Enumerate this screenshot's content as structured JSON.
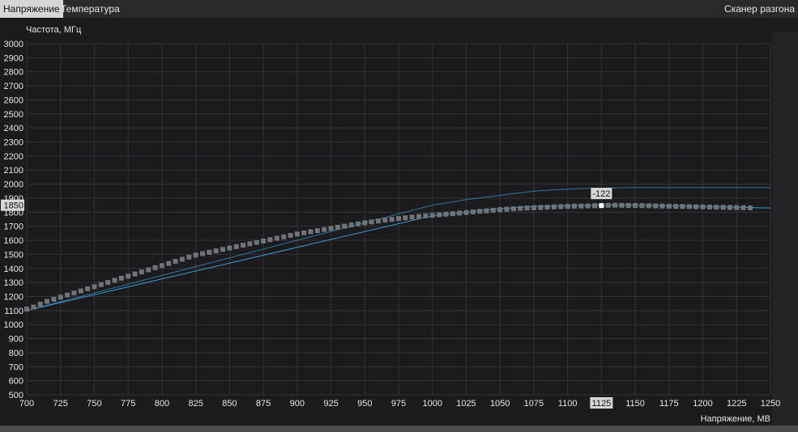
{
  "tabs": [
    {
      "label": "Напряжение",
      "active": true
    },
    {
      "label": "Температура",
      "active": false
    }
  ],
  "scanner_label": "Сканер разгона",
  "colors": {
    "grid": "#333338",
    "curve": "#3a9ad2",
    "point": "#6f7478",
    "point_selected": "#ffffff",
    "highlight_bg": "#d6d6d6"
  },
  "chart_data": {
    "type": "line",
    "ylabel": "Частота, МГц",
    "xlabel": "Напряжение, МВ",
    "xlim": [
      700,
      1250
    ],
    "ylim": [
      500,
      3000
    ],
    "x_ticks": [
      700,
      725,
      750,
      775,
      800,
      825,
      850,
      875,
      900,
      925,
      950,
      975,
      1000,
      1025,
      1050,
      1075,
      1100,
      1125,
      1150,
      1175,
      1200,
      1225,
      1250
    ],
    "y_ticks": [
      500,
      600,
      700,
      800,
      900,
      1000,
      1100,
      1200,
      1300,
      1400,
      1500,
      1600,
      1700,
      1800,
      1850,
      1900,
      2000,
      2100,
      2200,
      2300,
      2400,
      2500,
      2600,
      2700,
      2800,
      2900,
      3000
    ],
    "highlight_x": "1125",
    "highlight_y": "1850",
    "annotation": "-122",
    "series": [
      {
        "x": [
          700,
          1000,
          1025,
          1050,
          1075,
          1100,
          1125,
          1150,
          1250
        ],
        "y": [
          1100,
          1850,
          1890,
          1920,
          1950,
          1965,
          1972,
          1975,
          1975
        ]
      },
      {
        "x": [
          700,
          1000,
          1025,
          1050,
          1075,
          1100,
          1125,
          1150,
          1175,
          1200,
          1225,
          1250
        ],
        "y": [
          1100,
          1775,
          1800,
          1825,
          1840,
          1845,
          1850,
          1850,
          1845,
          1840,
          1835,
          1830
        ]
      }
    ],
    "points": {
      "x": [
        700,
        705,
        710,
        715,
        720,
        725,
        730,
        735,
        740,
        745,
        750,
        755,
        760,
        765,
        770,
        775,
        780,
        785,
        790,
        795,
        800,
        805,
        810,
        815,
        820,
        825,
        830,
        835,
        840,
        845,
        850,
        855,
        860,
        865,
        870,
        875,
        880,
        885,
        890,
        895,
        900,
        905,
        910,
        915,
        920,
        925,
        930,
        935,
        940,
        945,
        950,
        955,
        960,
        965,
        970,
        975,
        980,
        985,
        990,
        995,
        1000,
        1005,
        1010,
        1015,
        1020,
        1025,
        1030,
        1035,
        1040,
        1045,
        1050,
        1055,
        1060,
        1065,
        1070,
        1075,
        1080,
        1085,
        1090,
        1095,
        1100,
        1105,
        1110,
        1115,
        1120,
        1125,
        1130,
        1135,
        1140,
        1145,
        1150,
        1155,
        1160,
        1165,
        1170,
        1175,
        1180,
        1185,
        1190,
        1195,
        1200,
        1205,
        1210,
        1215,
        1220,
        1225,
        1230,
        1235
      ],
      "y": [
        1110,
        1125,
        1145,
        1165,
        1180,
        1195,
        1210,
        1225,
        1240,
        1255,
        1270,
        1285,
        1300,
        1315,
        1330,
        1345,
        1360,
        1375,
        1390,
        1405,
        1420,
        1435,
        1450,
        1465,
        1480,
        1495,
        1505,
        1515,
        1525,
        1535,
        1545,
        1555,
        1565,
        1575,
        1585,
        1595,
        1605,
        1615,
        1625,
        1635,
        1645,
        1653,
        1661,
        1669,
        1677,
        1685,
        1693,
        1701,
        1709,
        1717,
        1725,
        1731,
        1737,
        1743,
        1749,
        1755,
        1760,
        1765,
        1770,
        1774,
        1778,
        1782,
        1786,
        1790,
        1794,
        1798,
        1802,
        1806,
        1810,
        1814,
        1818,
        1821,
        1824,
        1827,
        1830,
        1832,
        1834,
        1836,
        1838,
        1840,
        1842,
        1843,
        1844,
        1845,
        1846,
        1847,
        1849,
        1850,
        1849,
        1848,
        1848,
        1847,
        1846,
        1845,
        1844,
        1843,
        1842,
        1841,
        1840,
        1839,
        1838,
        1837,
        1836,
        1835,
        1834,
        1833,
        1832,
        1831
      ],
      "selected_x": 1125
    }
  }
}
